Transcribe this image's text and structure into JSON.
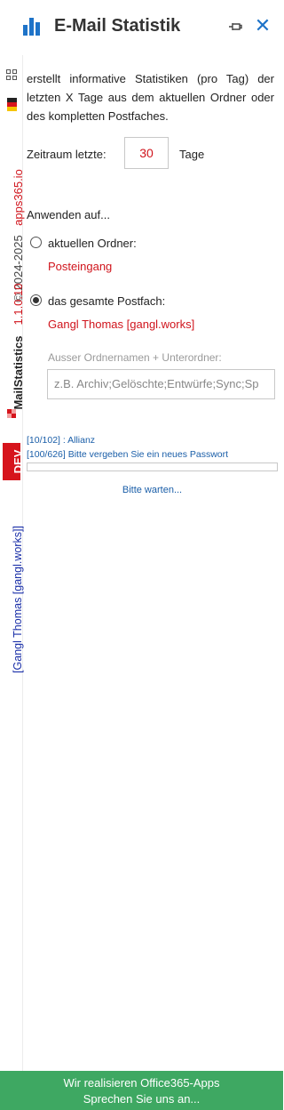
{
  "header": {
    "title": "E-Mail Statistik",
    "logo_icon": "bar-chart-icon",
    "pin_icon": "pin-icon",
    "close_icon": "close-icon",
    "close_glyph": "✕",
    "accent_color": "#1e73c8"
  },
  "sidebar": {
    "site": "apps365.io",
    "copyright": "© 2024-2025",
    "version": "1.1.0.10",
    "app_name": "MailStatistics",
    "dev_badge": "DEV",
    "user": "[Gangl Thomas [gangl.works]]",
    "grid_icon": "grid-icon",
    "flag_icon": "flag-icon",
    "brand_icon": "app-logo-icon"
  },
  "main": {
    "description": "erstellt informative Statistiken (pro Tag) der letzten X Tage aus dem aktuellen Ordner oder des kompletten Postfaches.",
    "period_label": "Zeitraum letzte:",
    "period_value": "30",
    "period_unit": "Tage",
    "apply_label": "Anwenden auf...",
    "option_folder_label": "aktuellen Ordner:",
    "option_folder_value": "Posteingang",
    "option_folder_selected": false,
    "option_mailbox_label": "das gesamte Postfach:",
    "option_mailbox_value": "Gangl Thomas [gangl.works]",
    "option_mailbox_selected": true,
    "exclude_label": "Ausser Ordnernamen + Unterordner:",
    "exclude_placeholder": "z.B. Archiv;Gelöschte;Entwürfe;Sync;Sp",
    "log_lines": [
      "[10/102] : Allianz",
      "[100/626] Bitte vergeben Sie ein neues Passwort"
    ],
    "progress": 0,
    "wait_text": "Bitte warten..."
  },
  "footer": {
    "line1": "Wir realisieren Office365-Apps",
    "line2": "Sprechen Sie uns an...",
    "color": "#3ea862"
  }
}
